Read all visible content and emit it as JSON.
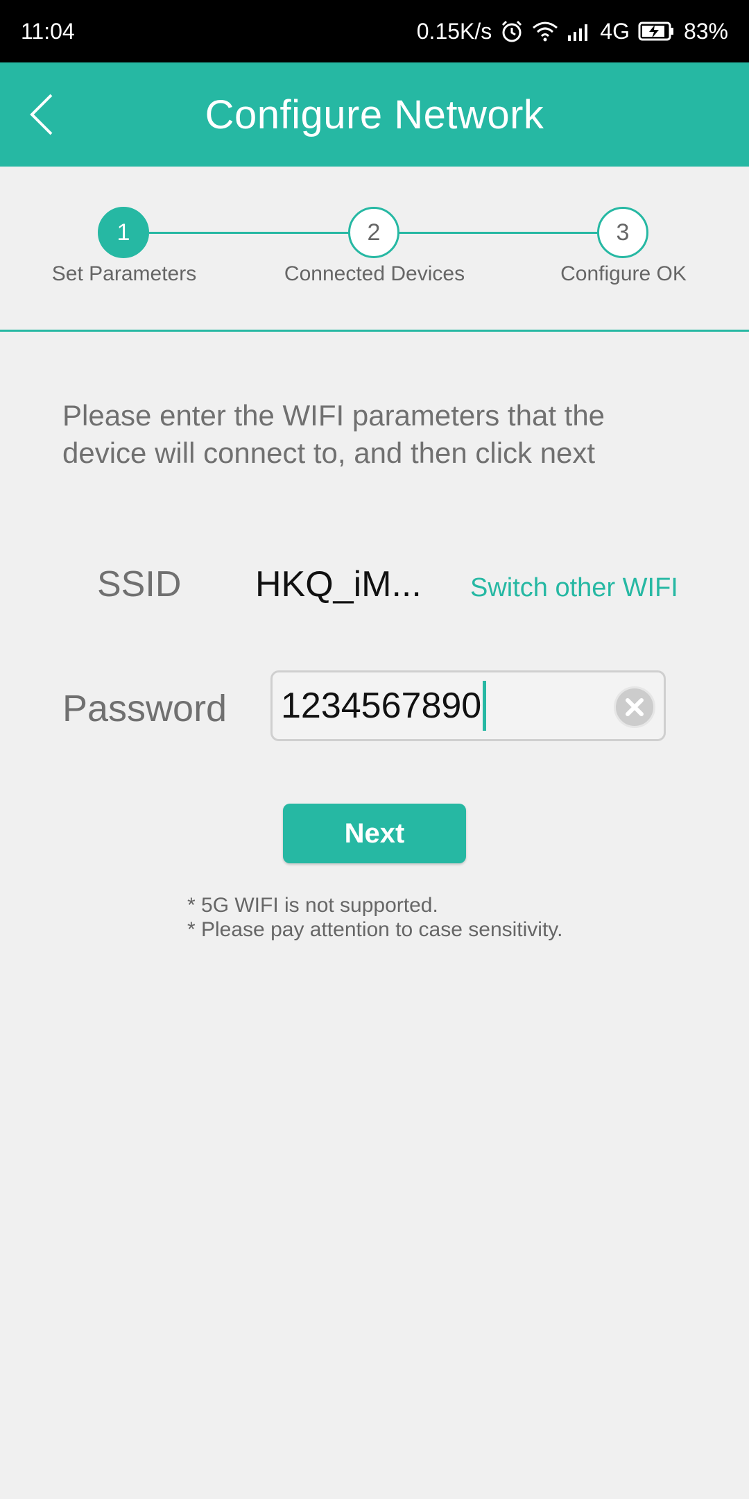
{
  "status_bar": {
    "time": "11:04",
    "network_speed": "0.15K/s",
    "network_type": "4G",
    "battery": "83%",
    "icons": [
      "alarm-icon",
      "wifi-icon",
      "signal-icon",
      "battery-charging-icon"
    ]
  },
  "header": {
    "title": "Configure Network",
    "back_icon": "chevron-left-icon"
  },
  "stepper": {
    "steps": [
      {
        "number": "1",
        "label": "Set Parameters",
        "active": true
      },
      {
        "number": "2",
        "label": "Connected Devices",
        "active": false
      },
      {
        "number": "3",
        "label": "Configure OK",
        "active": false
      }
    ]
  },
  "form": {
    "instruction": "Please enter the WIFI parameters that the device will connect to, and then click next",
    "ssid_label": "SSID",
    "ssid_value": "HKQ_iM...",
    "switch_wifi_label": "Switch other WIFI",
    "password_label": "Password",
    "password_value": "1234567890",
    "clear_icon": "clear-circle-icon",
    "next_label": "Next"
  },
  "notes": [
    "* 5G WIFI is not supported.",
    "* Please pay attention to case sensitivity."
  ],
  "colors": {
    "accent": "#26b8a3",
    "background": "#f0f0f0",
    "status_bar": "#000000"
  }
}
